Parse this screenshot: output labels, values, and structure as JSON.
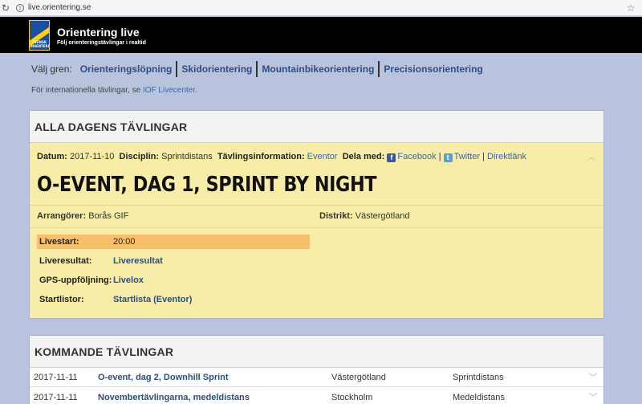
{
  "browser": {
    "url": "live.orientering.se"
  },
  "header": {
    "logo_text": "SVENSK ORIENTERING",
    "title": "Orientering live",
    "subtitle": "Följ orienteringstävlingar i realtid"
  },
  "sport_nav": {
    "label": "Välj gren:",
    "items": [
      "Orienteringslöpning",
      "Skidorientering",
      "Mountainbikeorientering",
      "Precisionsorientering"
    ]
  },
  "intl": {
    "text": "För internationella tävlingar, se",
    "link": "IOF Livecenter."
  },
  "today": {
    "heading": "ALLA DAGENS TÄVLINGAR",
    "date_label": "Datum:",
    "date": "2017-11-10",
    "discipline_label": "Disciplin:",
    "discipline": "Sprintdistans",
    "info_label": "Tävlingsinformation:",
    "info_link": "Eventor",
    "share_label": "Dela med:",
    "facebook": "Facebook",
    "twitter": "Twitter",
    "direct": "Direktlänk",
    "sep": "|",
    "title": "O-EVENT, DAG 1, SPRINT BY NIGHT",
    "organizer_label": "Arrangörer:",
    "organizer": "Borås GIF",
    "district_label": "Distrikt:",
    "district": "Västergötland",
    "rows": [
      {
        "k": "Livestart:",
        "v": "20:00"
      },
      {
        "k": "Liveresultat:",
        "v": "Liveresultat"
      },
      {
        "k": "GPS-uppföljning:",
        "v": "Livelox"
      },
      {
        "k": "Startlistor:",
        "v": "Startlista (Eventor)"
      }
    ]
  },
  "upcoming": {
    "heading": "KOMMANDE TÄVLINGAR",
    "rows": [
      {
        "date": "2017-11-11",
        "name": "O-event, dag 2, Downhill Sprint",
        "district": "Västergötland",
        "discipline": "Sprintdistans"
      },
      {
        "date": "2017-11-11",
        "name": "Novembertävlingarna, medeldistans",
        "district": "Stockholm",
        "discipline": "Medeldistans"
      }
    ]
  },
  "colors": {
    "header_bg": "#000000",
    "page_bg": "#b9c3de",
    "event_bg": "#f8eda6",
    "highlight": "#f9be6a",
    "link": "#2d4d82"
  }
}
